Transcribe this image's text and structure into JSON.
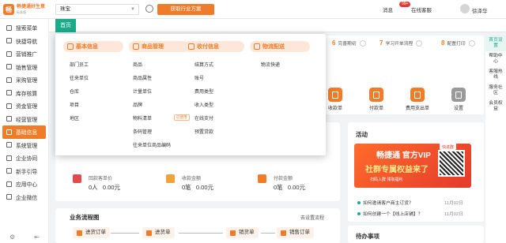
{
  "app": {
    "logo_mark": "畅",
    "logo_title": "畅捷通好生意",
    "logo_sub": "标准版",
    "industry_value": "珠宝",
    "industry_button": "获取行业方案",
    "message_label": "消息",
    "message_badge": "99+",
    "service_label": "在线客服",
    "username": "徐泽华"
  },
  "sidebar": {
    "items": [
      {
        "label": "搜索菜单"
      },
      {
        "label": "快捷导航"
      },
      {
        "label": "营销推广"
      },
      {
        "label": "销售管理"
      },
      {
        "label": "采购管理"
      },
      {
        "label": "库存核算"
      },
      {
        "label": "资金管理"
      },
      {
        "label": "经营管理"
      },
      {
        "label": "基础信息"
      },
      {
        "label": "系统管理"
      },
      {
        "label": "企业协同"
      },
      {
        "label": "新手引导"
      },
      {
        "label": "应用中心"
      },
      {
        "label": "企业微信"
      }
    ],
    "active_index": 8,
    "bottom_icons": [
      "gear-icon",
      "collapse-icon"
    ]
  },
  "tabs": {
    "home": "首页"
  },
  "steps": [
    {
      "num": "6",
      "label": "完善期初"
    },
    {
      "num": "7",
      "label": "学习开单流程"
    },
    {
      "num": "8",
      "label": "配置打印"
    }
  ],
  "shortcuts": [
    {
      "label": "收款单",
      "color": "#f07c2a"
    },
    {
      "label": "付款单",
      "color": "#f07c2a"
    },
    {
      "label": "费用支出单",
      "color": "#f07c2a"
    },
    {
      "label": "设置",
      "color": "#9a9a9a"
    }
  ],
  "stats": [
    {
      "label": "回款客单价",
      "value": "0人   0.00元"
    },
    {
      "label": "收款金额",
      "value": "0笔   0.00元"
    },
    {
      "label": "付款金额",
      "value": "0笔   0.00元"
    }
  ],
  "flow": {
    "title": "业务流程图",
    "link": "去设置流程",
    "items": [
      "进货订单",
      "进货单",
      "销货单",
      "销售订单"
    ]
  },
  "activity": {
    "title": "活动",
    "banner_tag": "快进群",
    "banner_line1": "畅捷通 官方VIP",
    "banner_line2": "社群专属权益来了",
    "banner_line3": "扫码入群  领取福利",
    "news": [
      {
        "title": "如何邀请客户商主订货？",
        "date": "11月02日"
      },
      {
        "title": "如何创建一个【线上店铺】？",
        "date": "11月02日"
      }
    ]
  },
  "todo": {
    "title": "待办事项"
  },
  "rightbar": {
    "items": [
      "首页设置",
      "帮助中心",
      "客服热线",
      "服务社区",
      "会员权益"
    ]
  },
  "dropdown": {
    "categories": [
      "基本信息",
      "商品管理",
      "收付信息",
      "物流配送"
    ],
    "columns": [
      [
        "部门员工",
        "往来单位",
        "仓库",
        "项目",
        "地区"
      ],
      [
        "商品",
        "商品属性",
        "计量单位",
        "品牌",
        "物料清单",
        "条码管理",
        "往来单位商品编码"
      ],
      [
        "结算方式",
        "账号",
        "费用类型",
        "收入类型",
        "在线支付",
        "预置贷款"
      ],
      [
        "物流快递"
      ]
    ],
    "badge": "已使用"
  }
}
